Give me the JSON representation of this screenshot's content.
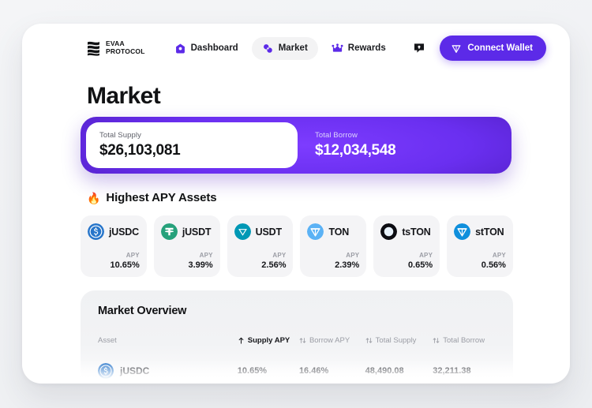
{
  "brand": {
    "name": "EVAA\nPROTOCOL"
  },
  "nav": {
    "items": [
      {
        "label": "Dashboard",
        "icon": "home-icon",
        "active": false
      },
      {
        "label": "Market",
        "icon": "market-icon",
        "active": true
      },
      {
        "label": "Rewards",
        "icon": "crown-icon",
        "active": false
      }
    ]
  },
  "header": {
    "notifications_icon": "chat-bubble-icon",
    "connect_wallet_label": "Connect Wallet",
    "connect_wallet_icon": "ton-diamond-icon",
    "accent_color": "#5c2ae8"
  },
  "page": {
    "title": "Market"
  },
  "totals": {
    "supply_label": "Total Supply",
    "supply_value": "$26,103,081",
    "borrow_label": "Total Borrow",
    "borrow_value": "$12,034,548"
  },
  "highest_apy": {
    "icon": "fire-icon",
    "emoji": "🔥",
    "title": "Highest APY Assets",
    "apy_label": "APY",
    "cards": [
      {
        "symbol": "jUSDC",
        "apy": "10.65%",
        "color": "#2775ca",
        "icon": "usdc-coin-icon"
      },
      {
        "symbol": "jUSDT",
        "apy": "3.99%",
        "color": "#26a17b",
        "icon": "usdt-coin-icon"
      },
      {
        "symbol": "USDT",
        "apy": "2.56%",
        "color": "#0098b5",
        "icon": "usdt-ton-coin-icon"
      },
      {
        "symbol": "TON",
        "apy": "2.39%",
        "color": "#5bb2f5",
        "icon": "ton-coin-icon"
      },
      {
        "symbol": "tsTON",
        "apy": "0.65%",
        "color": "#0c0c12",
        "icon": "tston-coin-icon"
      },
      {
        "symbol": "stTON",
        "apy": "0.56%",
        "color": "#0f8fdc",
        "icon": "stton-coin-icon"
      }
    ]
  },
  "market_overview": {
    "title": "Market Overview",
    "columns": [
      {
        "label": "Asset",
        "sort": "none",
        "active": false
      },
      {
        "label": "Supply APY",
        "sort": "asc",
        "active": true
      },
      {
        "label": "Borrow APY",
        "sort": "both",
        "active": false
      },
      {
        "label": "Total Supply",
        "sort": "both",
        "active": false
      },
      {
        "label": "Total Borrow",
        "sort": "both",
        "active": false
      }
    ],
    "rows": [
      {
        "asset": "jUSDC",
        "color": "#2775ca",
        "supply_apy": "10.65%",
        "borrow_apy": "16.46%",
        "total_supply": "48,490.08",
        "total_borrow": "32,211.38"
      }
    ]
  }
}
